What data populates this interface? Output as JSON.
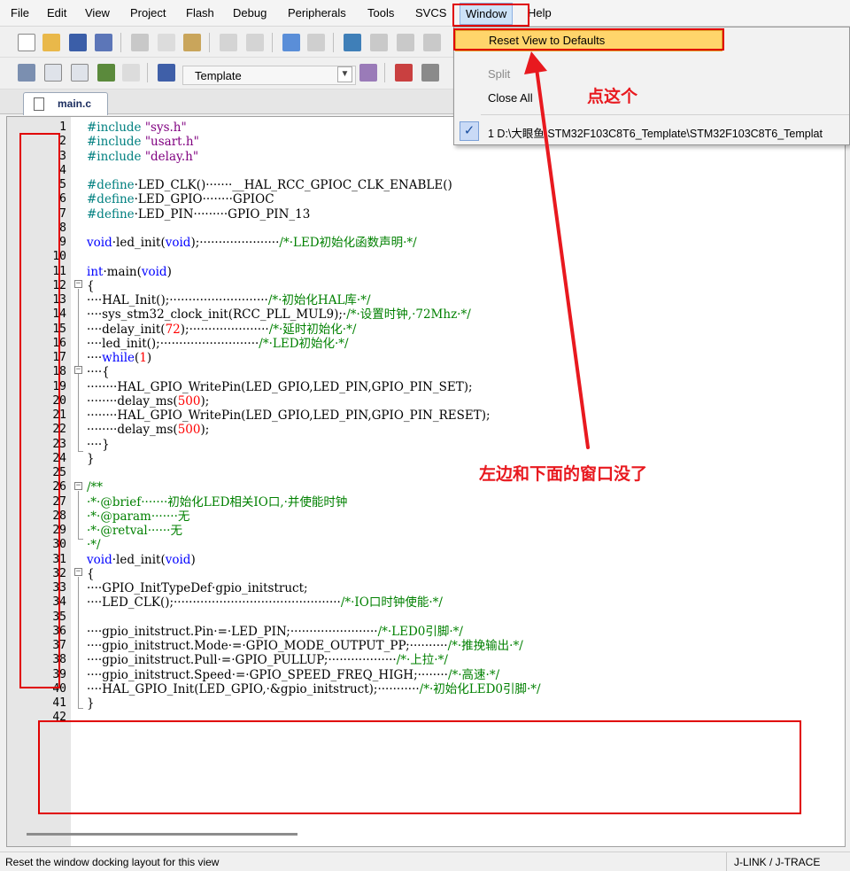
{
  "menubar": {
    "items": [
      "File",
      "Edit",
      "View",
      "Project",
      "Flash",
      "Debug",
      "Peripherals",
      "Tools",
      "SVCS",
      "Window",
      "Help"
    ]
  },
  "toolbar2": {
    "target_name": "Template"
  },
  "tabs": [
    {
      "label": "main.c"
    }
  ],
  "window_menu": {
    "items": {
      "reset_view": "Reset View to Defaults",
      "split": "Split",
      "close_all": "Close All",
      "recent": "1 D:\\大眼鱼\\STM32F103C8T6_Template\\STM32F103C8T6_Templat"
    }
  },
  "editor": {
    "line_numbers": [
      "1",
      "2",
      "3",
      "4",
      "5",
      "6",
      "7",
      "8",
      "9",
      "10",
      "11",
      "12",
      "13",
      "14",
      "15",
      "16",
      "17",
      "18",
      "19",
      "20",
      "21",
      "22",
      "23",
      "24",
      "25",
      "26",
      "27",
      "28",
      "29",
      "30",
      "31",
      "32",
      "33",
      "34",
      "35",
      "36",
      "37",
      "38",
      "39",
      "40",
      "41",
      "42"
    ],
    "lines": [
      [
        [
          "pp",
          "#include "
        ],
        [
          "str",
          "\"sys.h\""
        ]
      ],
      [
        [
          "pp",
          "#include "
        ],
        [
          "str",
          "\"usart.h\""
        ]
      ],
      [
        [
          "pp",
          "#include "
        ],
        [
          "str",
          "\"delay.h\""
        ]
      ],
      [],
      [
        [
          "pp",
          "#define"
        ],
        [
          "",
          "·LED_CLK()·······__HAL_RCC_GPIOC_CLK_ENABLE()"
        ]
      ],
      [
        [
          "pp",
          "#define"
        ],
        [
          "",
          "·LED_GPIO········GPIOC"
        ]
      ],
      [
        [
          "pp",
          "#define"
        ],
        [
          "",
          "·LED_PIN·········GPIO_PIN_13"
        ]
      ],
      [],
      [
        [
          "kw",
          "void"
        ],
        [
          "",
          "·led_init("
        ],
        [
          "kw",
          "void"
        ],
        [
          "",
          ");·····················"
        ],
        [
          "cm",
          "/*·LED初始化函数声明·*/"
        ]
      ],
      [],
      [
        [
          "kw",
          "int"
        ],
        [
          "",
          "·main("
        ],
        [
          "kw",
          "void"
        ],
        [
          "",
          ")"
        ]
      ],
      [
        [
          "",
          "{"
        ]
      ],
      [
        [
          "",
          "····HAL_Init();··························"
        ],
        [
          "cm",
          "/*·初始化HAL库·*/"
        ]
      ],
      [
        [
          "",
          "····sys_stm32_clock_init(RCC_PLL_MUL9);·"
        ],
        [
          "cm",
          "/*·设置时钟,·72Mhz·*/"
        ]
      ],
      [
        [
          "",
          "····delay_init("
        ],
        [
          "nm",
          "72"
        ],
        [
          "",
          ");·····················"
        ],
        [
          "cm",
          "/*·延时初始化·*/"
        ]
      ],
      [
        [
          "",
          "····led_init();··························"
        ],
        [
          "cm",
          "/*·LED初始化·*/"
        ]
      ],
      [
        [
          "",
          "····"
        ],
        [
          "kw",
          "while"
        ],
        [
          "",
          "("
        ],
        [
          "nm",
          "1"
        ],
        [
          "",
          ")"
        ]
      ],
      [
        [
          "",
          "····{"
        ]
      ],
      [
        [
          "",
          "········HAL_GPIO_WritePin(LED_GPIO,LED_PIN,GPIO_PIN_SET);"
        ]
      ],
      [
        [
          "",
          "········delay_ms("
        ],
        [
          "nm",
          "500"
        ],
        [
          "",
          ");"
        ]
      ],
      [
        [
          "",
          "········HAL_GPIO_WritePin(LED_GPIO,LED_PIN,GPIO_PIN_RESET);"
        ]
      ],
      [
        [
          "",
          "········delay_ms("
        ],
        [
          "nm",
          "500"
        ],
        [
          "",
          ");"
        ]
      ],
      [
        [
          "",
          "····}"
        ]
      ],
      [
        [
          "",
          "}"
        ]
      ],
      [],
      [
        [
          "cm",
          "/**"
        ]
      ],
      [
        [
          "cm",
          "·*·@brief·······初始化LED相关IO口,·并使能时钟"
        ]
      ],
      [
        [
          "cm",
          "·*·@param·······无"
        ]
      ],
      [
        [
          "cm",
          "·*·@retval······无"
        ]
      ],
      [
        [
          "cm",
          "·*/"
        ]
      ],
      [
        [
          "kw",
          "void"
        ],
        [
          "",
          "·led_init("
        ],
        [
          "kw",
          "void"
        ],
        [
          "",
          ")"
        ]
      ],
      [
        [
          "",
          "{"
        ]
      ],
      [
        [
          "",
          "····GPIO_InitTypeDef·gpio_initstruct;"
        ]
      ],
      [
        [
          "",
          "····LED_CLK();············································"
        ],
        [
          "cm",
          "/*·IO口时钟使能·*/"
        ]
      ],
      [],
      [
        [
          "",
          "····gpio_initstruct.Pin·=·LED_PIN;·······················"
        ],
        [
          "cm",
          "/*·LED0引脚·*/"
        ]
      ],
      [
        [
          "",
          "····gpio_initstruct.Mode·=·GPIO_MODE_OUTPUT_PP;··········"
        ],
        [
          "cm",
          "/*·推挽输出·*/"
        ]
      ],
      [
        [
          "",
          "····gpio_initstruct.Pull·=·GPIO_PULLUP;··················"
        ],
        [
          "cm",
          "/*·上拉·*/"
        ]
      ],
      [
        [
          "",
          "····gpio_initstruct.Speed·=·GPIO_SPEED_FREQ_HIGH;········"
        ],
        [
          "cm",
          "/*·高速·*/"
        ]
      ],
      [
        [
          "",
          "····HAL_GPIO_Init(LED_GPIO,·&gpio_initstruct);···········"
        ],
        [
          "cm",
          "/*·初始化LED0引脚·*/"
        ]
      ],
      [
        [
          "",
          "}"
        ]
      ],
      []
    ]
  },
  "statusbar": {
    "text": "Reset the window docking layout for this view",
    "debugger": "J-LINK / J-TRACE"
  },
  "annotations": {
    "click_this": "点这个",
    "windows_gone": "左边和下面的窗口没了",
    "color": "#e8191f"
  }
}
